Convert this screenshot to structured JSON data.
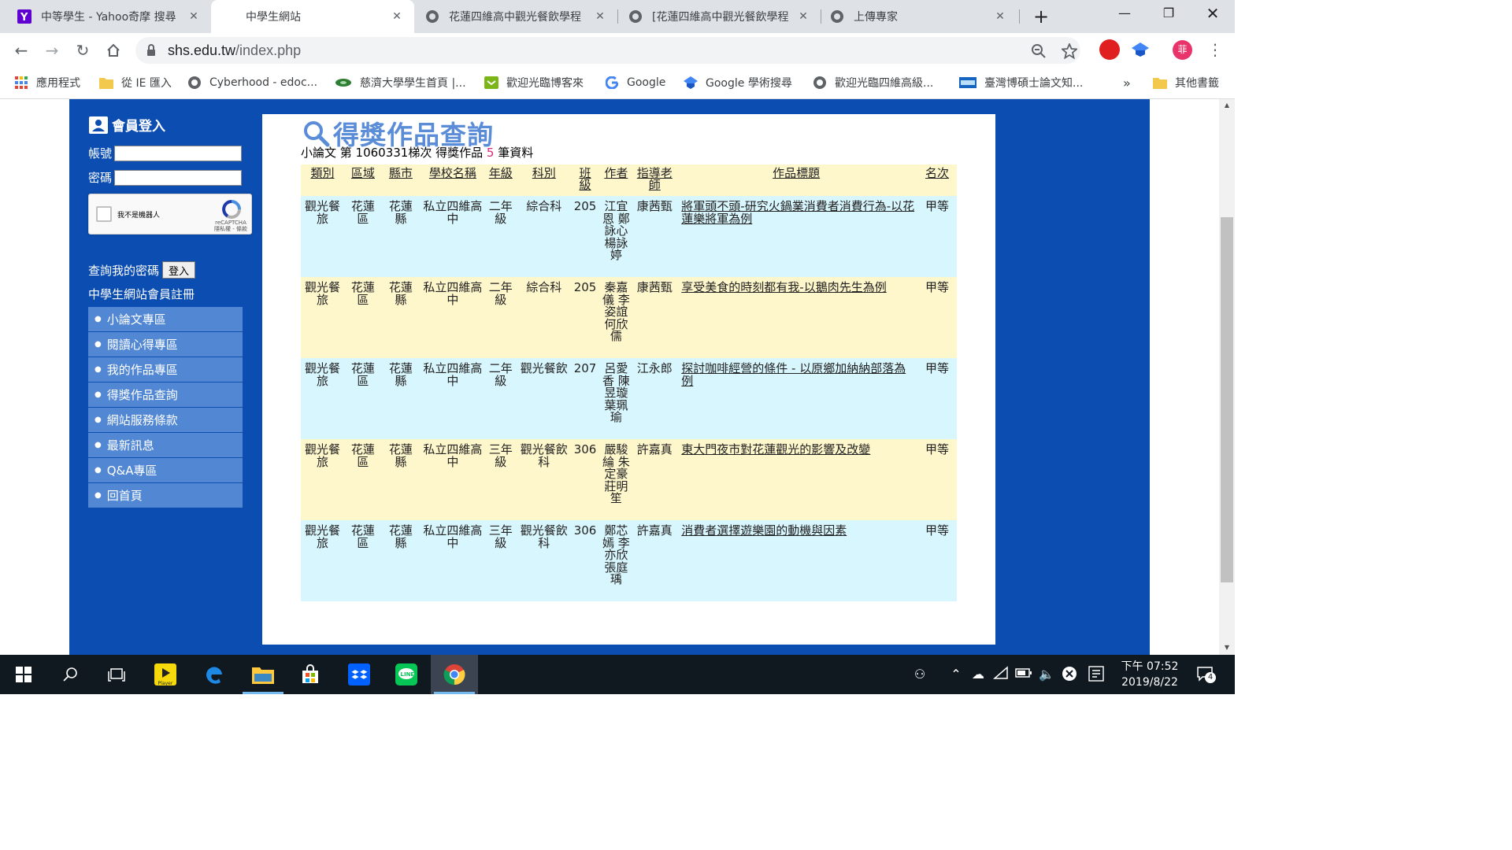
{
  "browser": {
    "tabs": [
      {
        "title": "中等學生 - Yahoo奇摩 搜尋",
        "active": false
      },
      {
        "title": "中學生網站",
        "active": true
      },
      {
        "title": "花蓮四維高中觀光餐飲學程",
        "active": false
      },
      {
        "title": "[花蓮四維高中觀光餐飲學程",
        "active": false
      },
      {
        "title": "上傳專家",
        "active": false
      }
    ],
    "url_domain": "shs.edu.tw",
    "url_path": "/index.php",
    "profile_initial": "菲",
    "bookmarks": [
      {
        "label": "應用程式",
        "icon": "apps-grid-icon"
      },
      {
        "label": "從 IE 匯入",
        "icon": "folder-icon"
      },
      {
        "label": "Cyberhood - edoc...",
        "icon": "globe-icon"
      },
      {
        "label": "慈濟大學學生首頁 |...",
        "icon": "site-icon"
      },
      {
        "label": "歡迎光臨博客來",
        "icon": "books-icon"
      },
      {
        "label": "Google",
        "icon": "google-icon"
      },
      {
        "label": "Google 學術搜尋",
        "icon": "scholar-icon"
      },
      {
        "label": "歡迎光臨四維高級...",
        "icon": "globe-icon"
      },
      {
        "label": "臺灣博碩士論文知...",
        "icon": "ndltd-icon"
      }
    ],
    "bookmarks_more": "»",
    "other_bookmarks": "其他書籤"
  },
  "sidebar": {
    "login_title": "會員登入",
    "account_label": "帳號",
    "password_label": "密碼",
    "recaptcha_label": "我不是機器人",
    "recaptcha_brand": "reCAPTCHA",
    "recaptcha_terms": "隱私權 - 條款",
    "forgot_label": "查詢我的密碼",
    "login_button": "登入",
    "register_link": "中學生網站會員註冊",
    "menu": [
      "小論文專區",
      "閱讀心得專區",
      "我的作品專區",
      "得獎作品查詢",
      "網站服務條款",
      "最新訊息",
      "Q&A專區",
      "回首頁"
    ]
  },
  "main": {
    "heading": "得獎作品查詢",
    "summary_prefix": "小論文 第 1060331梯次 得獎作品",
    "summary_count": "5",
    "summary_suffix": "筆資料",
    "columns": [
      "類別",
      "區域",
      "縣市",
      "學校名稱",
      "年級",
      "科別",
      "班級",
      "作者",
      "指導老師",
      "作品標題",
      "名次"
    ],
    "rows": [
      {
        "category": "觀光餐旅",
        "region": "花蓮區",
        "county": "花蓮縣",
        "school": "私立四維高中",
        "grade": "二年級",
        "dept": "綜合科",
        "class": "205",
        "authors": "江宜恩 鄭詠心 楊詠婷",
        "advisor": "康茜甄",
        "title": "將軍頭不頭-研究火鍋業消費者消費行為-以花蓮樂將軍為例",
        "rank": "甲等"
      },
      {
        "category": "觀光餐旅",
        "region": "花蓮區",
        "county": "花蓮縣",
        "school": "私立四維高中",
        "grade": "二年級",
        "dept": "綜合科",
        "class": "205",
        "authors": "秦嘉儀 李姿誼 何欣儒",
        "advisor": "康茜甄",
        "title": "享受美食的時刻都有我-以鵝肉先生為例",
        "rank": "甲等"
      },
      {
        "category": "觀光餐旅",
        "region": "花蓮區",
        "county": "花蓮縣",
        "school": "私立四維高中",
        "grade": "二年級",
        "dept": "觀光餐飲",
        "class": "207",
        "authors": "呂愛香 陳昱璇 葉珮瑜",
        "advisor": "江永郎",
        "title": "探討咖啡經營的條件 - 以原鄉加納納部落為例",
        "rank": "甲等"
      },
      {
        "category": "觀光餐旅",
        "region": "花蓮區",
        "county": "花蓮縣",
        "school": "私立四維高中",
        "grade": "三年級",
        "dept": "觀光餐飲科",
        "class": "306",
        "authors": "嚴駿綸 朱定豪 莊明笙",
        "advisor": "許嘉真",
        "title": "東大門夜市對花蓮觀光的影響及改變",
        "rank": "甲等"
      },
      {
        "category": "觀光餐旅",
        "region": "花蓮區",
        "county": "花蓮縣",
        "school": "私立四維高中",
        "grade": "三年級",
        "dept": "觀光餐飲科",
        "class": "306",
        "authors": "鄭芯嫣 李亦欣 張庭瑀",
        "advisor": "許嘉真",
        "title": "消費者選擇遊樂園的動機與因素",
        "rank": "甲等"
      }
    ]
  },
  "taskbar": {
    "clock_time": "下午 07:52",
    "clock_date": "2019/8/22",
    "notifications": "4",
    "player_label": "Player"
  },
  "colors": {
    "site_blue": "#0b4db0",
    "menu_blue": "#5288d3",
    "heading_blue": "#5a8cd8",
    "row_cyan": "#d8f6fd",
    "row_yellow": "#fff7cc",
    "count_pink": "#e0267b"
  }
}
